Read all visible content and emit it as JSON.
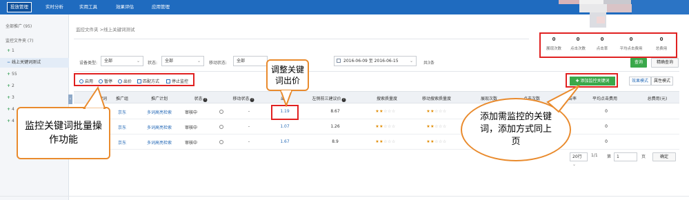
{
  "nav": {
    "tabs": [
      "投放管理",
      "实时分析",
      "实用工具",
      "效果评估",
      "应用管理"
    ]
  },
  "sidebar": {
    "all_promos": "全部推广 (95)",
    "monitor_folder": "监控文件夹 (7)",
    "items": [
      {
        "prefix": "+",
        "label": "1"
      },
      {
        "prefix": "−",
        "label": "线上关键词测试"
      },
      {
        "prefix": "+",
        "label": "55"
      },
      {
        "prefix": "+",
        "label": "2"
      },
      {
        "prefix": "+",
        "label": "3"
      },
      {
        "prefix": "+",
        "label": "4"
      },
      {
        "prefix": "+",
        "label": "4"
      }
    ]
  },
  "breadcrumb": "监控文件夹 >线上关键词测试",
  "stats": [
    {
      "value": "0",
      "label": "展现次数"
    },
    {
      "value": "0",
      "label": "点击次数"
    },
    {
      "value": "0",
      "label": "点击率"
    },
    {
      "value": "0",
      "label": "平均点击费用"
    },
    {
      "value": "0",
      "label": "总费用"
    }
  ],
  "filters": {
    "device_label": "设备类型:",
    "device_value": "全部",
    "status_label": "状态:",
    "status_value": "全部",
    "mobile_label": "移动状态:",
    "mobile_value": "全部",
    "date_range": "2016-06-09 至 2016-06-15",
    "total": "共3条",
    "query_btn": "查询",
    "precise_btn": "精确查询"
  },
  "toolbar": {
    "enable": "启用",
    "pause": "暂停",
    "bid": "出价",
    "match": "匹配方式",
    "stop_monitor": "停止监控"
  },
  "actions": {
    "add_keyword": "添加监控关键词",
    "effect_mode": "效果模式",
    "attr_mode": "属性模式"
  },
  "table": {
    "headers": [
      "关键词",
      "推广组",
      "推广计划",
      "状态",
      "移动状态",
      "出价",
      "左侧前三建议价",
      "搜索质量度",
      "移动搜索质量度",
      "展现次数",
      "点击次数",
      "点击率",
      "平均点击费用",
      "总费用(元)"
    ],
    "rows": [
      {
        "group": "京东",
        "plan": "多词高亮检索",
        "status": "审核中",
        "mobile": "-",
        "bid": "1.19",
        "suggest": "8.67",
        "q_stars": 2,
        "mq_stars": 2,
        "cpc": "0"
      },
      {
        "group": "京东",
        "plan": "多词高亮检索",
        "status": "审核中",
        "mobile": "-",
        "bid": "1.07",
        "suggest": "1.26",
        "q_stars": 2,
        "mq_stars": 2,
        "cpc": "0"
      },
      {
        "group": "京东",
        "plan": "多词高亮检索",
        "status": "审核中",
        "mobile": "-",
        "bid": "1.67",
        "suggest": "8.9",
        "q_stars": 2,
        "mq_stars": 2,
        "cpc": "0"
      }
    ]
  },
  "pager": {
    "page_size": "20行",
    "page_info": "1/1",
    "goto_label": "第",
    "page_value": "1",
    "page_unit": "页",
    "confirm": "确定"
  },
  "callouts": {
    "bid": "调整关键词出价",
    "batch": "监控关键词批量操作功能",
    "add": "添加需监控的关键词，添加方式同上页"
  },
  "colors": {
    "nav_blue": "#1f6bbf",
    "accent_green": "#3aa84a",
    "highlight_red": "#e02020",
    "callout_orange": "#e98a2c",
    "link_blue": "#2a6db8"
  }
}
